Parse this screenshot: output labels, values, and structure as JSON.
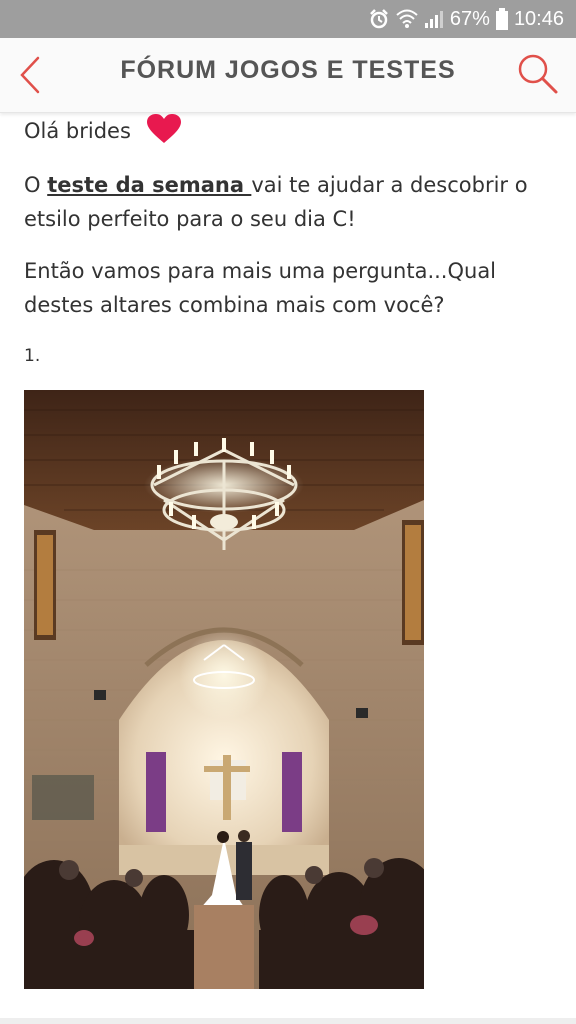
{
  "status_bar": {
    "battery": "67%",
    "time": "10:46"
  },
  "header": {
    "title": "FÓRUM JOGOS E TESTES"
  },
  "post": {
    "greeting": "Olá brides",
    "p2_before": "O ",
    "p2_link": "teste da semana ",
    "p2_after": "vai te ajudar a descobrir o etsilo perfeito para o seu dia C!",
    "p3": "Então vamos para mais uma pergunta...Qual destes altares combina mais com você?",
    "list_marker": "1."
  },
  "colors": {
    "accent": "#e0504a",
    "heart": "#e8194f",
    "status_bar": "#9e9e9e"
  },
  "icons": [
    "alarm-icon",
    "wifi-icon",
    "signal-icon",
    "battery-icon",
    "back-arrow-icon",
    "search-icon",
    "heart-icon"
  ]
}
